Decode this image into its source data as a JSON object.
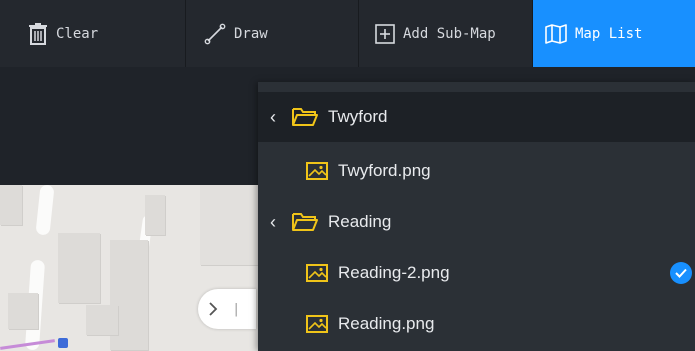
{
  "toolbar": {
    "clear_label": "Clear",
    "draw_label": "Draw",
    "add_submap_label": "Add Sub-Map",
    "map_list_label": "Map List",
    "active_color": "#1890ff"
  },
  "map": {
    "expand_icon": "chevron-right-icon"
  },
  "map_list": {
    "folders": [
      {
        "name": "Twyford",
        "files": [
          {
            "name": "Twyford.png",
            "selected": false
          }
        ]
      },
      {
        "name": "Reading",
        "files": [
          {
            "name": "Reading-2.png",
            "selected": true
          },
          {
            "name": "Reading.png",
            "selected": false
          }
        ]
      }
    ],
    "folder_icon_color": "#f0c419",
    "image_icon_color": "#f0c419",
    "selected_color": "#1890ff"
  }
}
